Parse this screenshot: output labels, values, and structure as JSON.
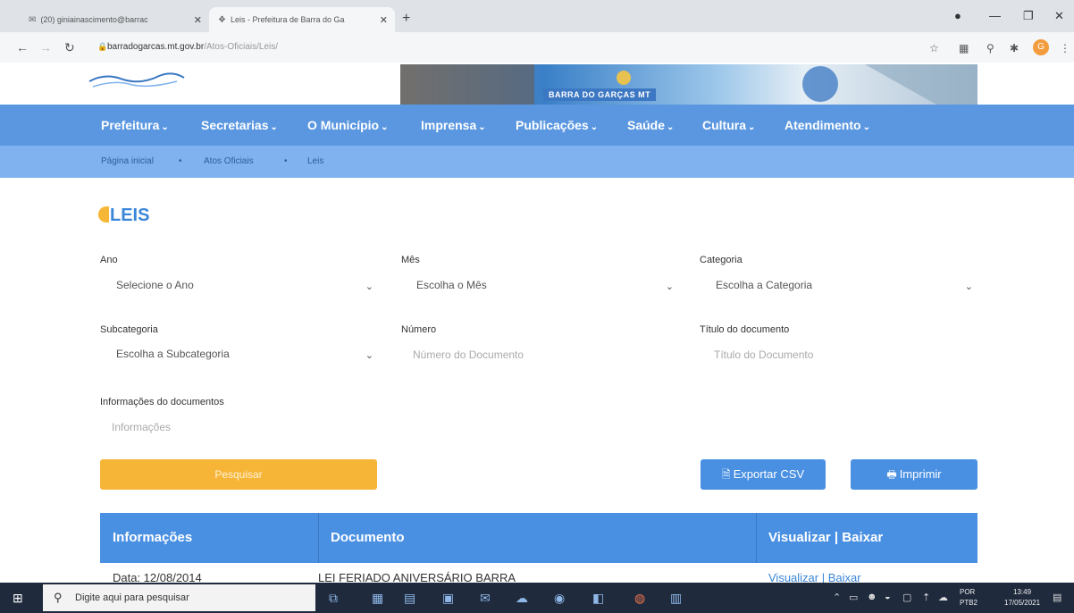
{
  "browser": {
    "tabs": [
      {
        "icon": "mail-icon",
        "label": "(20) giniainascimento@barrac"
      },
      {
        "icon": "site-icon",
        "label": "Leis - Prefeitura de Barra do Ga"
      }
    ],
    "url_host": "barradogarcas.mt.gov.br",
    "url_path": "/Atos-Oficiais/Leis/"
  },
  "banner": {
    "label": "BARRA DO GARÇAS MT"
  },
  "menu": {
    "items": [
      {
        "label": "Prefeitura"
      },
      {
        "label": "Secretarias"
      },
      {
        "label": "O Município"
      },
      {
        "label": "Imprensa"
      },
      {
        "label": "Publicações"
      },
      {
        "label": "Saúde"
      },
      {
        "label": "Cultura"
      },
      {
        "label": "Atendimento"
      }
    ]
  },
  "breadcrumb": {
    "items": [
      "Página inicial",
      "Atos Oficiais",
      "Leis"
    ],
    "separator": "•"
  },
  "page": {
    "title": "LEIS"
  },
  "form": {
    "ano": {
      "label": "Ano",
      "value": "Selecione o Ano"
    },
    "mes": {
      "label": "Mês",
      "value": "Escolha o Mês"
    },
    "categoria": {
      "label": "Categoria",
      "value": "Escolha a Categoria"
    },
    "subcategoria": {
      "label": "Subcategoria",
      "value": "Escolha a Subcategoria"
    },
    "numero": {
      "label": "Número",
      "placeholder": "Número do Documento"
    },
    "titulo": {
      "label": "Título do documento",
      "placeholder": "Título do Documento"
    },
    "informacoes": {
      "label": "Informações do documentos",
      "placeholder": "Informações"
    },
    "search_label": "Pesquisar",
    "export_label": "Exportar CSV",
    "print_label": "Imprimir"
  },
  "table": {
    "headers": [
      "Informações",
      "Documento",
      "Visualizar | Baixar"
    ],
    "rows": [
      {
        "info": "Data: 12/08/2014",
        "document": "LEI FERIADO ANIVERSÁRIO BARRA",
        "actions": "Visualizar | Baixar"
      }
    ]
  },
  "taskbar": {
    "search_placeholder": "Digite aqui para pesquisar",
    "lang_1": "POR",
    "lang_2": "PTB2",
    "time": "13:49",
    "date": "17/05/2021"
  },
  "colors": {
    "menu_blue": "#5a97e0",
    "accent_orange": "#f7b537",
    "button_blue": "#4a90e2"
  }
}
